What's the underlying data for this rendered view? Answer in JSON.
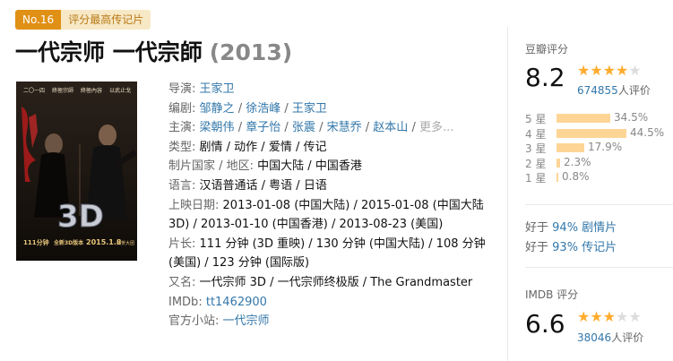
{
  "badge": {
    "no": "No.16",
    "text": "评分最高传记片"
  },
  "title": {
    "name": "一代宗师 一代宗師",
    "year": "(2013)"
  },
  "poster": {
    "top_texts": [
      "二〇一四",
      "終極宗師",
      "終極內容",
      "以武止戈"
    ],
    "big_text": "3D",
    "date_text": "2015.1.8",
    "left_bottom_text": "111分钟",
    "mid_bottom_text": "全新3D版本",
    "right_bottom_text": "共贺大团"
  },
  "info": {
    "director": {
      "label": "导演:",
      "values": [
        "王家卫"
      ]
    },
    "writer": {
      "label": "编剧:",
      "values": [
        "邹静之",
        "徐浩峰",
        "王家卫"
      ]
    },
    "cast": {
      "label": "主演:",
      "values": [
        "梁朝伟",
        "章子怡",
        "张震",
        "宋慧乔",
        "赵本山"
      ],
      "more": "更多..."
    },
    "genre": {
      "label": "类型:",
      "value": "剧情 / 动作 / 爱情 / 传记"
    },
    "country": {
      "label": "制片国家 / 地区:",
      "value": "中国大陆 / 中国香港"
    },
    "language": {
      "label": "语言:",
      "value": "汉语普通话 / 粤语 / 日语"
    },
    "release": {
      "label": "上映日期:",
      "line1": "2013-01-08 (中国大陆) / 2015-01-08 (中国大陆",
      "line2": "3D) / 2013-01-10 (中国香港) / 2013-08-23 (美国)"
    },
    "runtime": {
      "label": "片长:",
      "line1": "111 分钟 (3D 重映) / 130 分钟 (中国大陆) / 108 分钟",
      "line2": "(美国) / 123 分钟 (国际版)"
    },
    "aka": {
      "label": "又名:",
      "value": "一代宗师 3D / 一代宗师终极版 / The Grandmaster"
    },
    "imdb": {
      "label": "IMDb:",
      "value": "tt1462900"
    },
    "site": {
      "label": "官方小站:",
      "value": "一代宗师"
    }
  },
  "douban": {
    "heading": "豆瓣评分",
    "score": "8.2",
    "stars": 4,
    "count": "674855",
    "count_suffix": "人评价",
    "distribution": [
      {
        "label": "5 星",
        "pct": "34.5%",
        "value": 34.5
      },
      {
        "label": "4 星",
        "pct": "44.5%",
        "value": 44.5
      },
      {
        "label": "3 星",
        "pct": "17.9%",
        "value": 17.9
      },
      {
        "label": "2 星",
        "pct": "2.3%",
        "value": 2.3
      },
      {
        "label": "1 星",
        "pct": "0.8%",
        "value": 0.8
      }
    ],
    "better": [
      {
        "prefix": "好于",
        "link": "94% 剧情片"
      },
      {
        "prefix": "好于",
        "link": "93% 传记片"
      }
    ]
  },
  "imdb_rating": {
    "heading": "IMDB 评分",
    "score": "6.6",
    "stars": 3,
    "count": "38046",
    "count_suffix": "人评价"
  },
  "colors": {
    "link": "#3377aa",
    "star": "#ffac2d",
    "bar": "#ffd596",
    "badge": "#e09015"
  }
}
